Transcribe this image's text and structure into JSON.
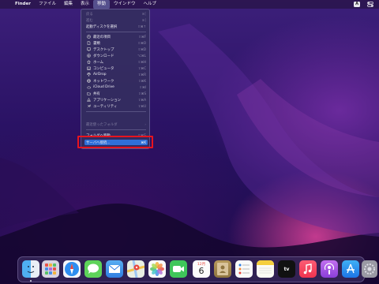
{
  "menubar": {
    "apple": "",
    "app_name": "Finder",
    "items": [
      "ファイル",
      "編集",
      "表示",
      "移動",
      "ウインドウ",
      "ヘルプ"
    ],
    "active_item": "移動",
    "input_source": "A"
  },
  "go_menu": {
    "items": [
      {
        "label": "戻る",
        "shortcut": "⌘[",
        "icon": "",
        "enabled": false
      },
      {
        "label": "進む",
        "shortcut": "⌘]",
        "icon": "",
        "enabled": false
      },
      {
        "label": "起動ディスクを選択",
        "shortcut": "⇧⌘↑",
        "icon": "",
        "enabled": true
      },
      {
        "label": "最近の項目",
        "shortcut": "⇧⌘F",
        "icon": "recents-icon",
        "enabled": true
      },
      {
        "label": "書類",
        "shortcut": "⇧⌘O",
        "icon": "document-icon",
        "enabled": true
      },
      {
        "label": "デスクトップ",
        "shortcut": "⇧⌘D",
        "icon": "desktop-icon",
        "enabled": true
      },
      {
        "label": "ダウンロード",
        "shortcut": "⌥⌘L",
        "icon": "download-icon",
        "enabled": true
      },
      {
        "label": "ホーム",
        "shortcut": "⇧⌘H",
        "icon": "home-icon",
        "enabled": true
      },
      {
        "label": "コンピュータ",
        "shortcut": "⇧⌘C",
        "icon": "computer-icon",
        "enabled": true
      },
      {
        "label": "AirDrop",
        "shortcut": "⇧⌘R",
        "icon": "airdrop-icon",
        "enabled": true
      },
      {
        "label": "ネットワーク",
        "shortcut": "⇧⌘K",
        "icon": "network-icon",
        "enabled": true
      },
      {
        "label": "iCloud Drive",
        "shortcut": "⇧⌘I",
        "icon": "icloud-icon",
        "enabled": true
      },
      {
        "label": "共有",
        "shortcut": "⇧⌘S",
        "icon": "shared-icon",
        "enabled": true
      },
      {
        "label": "アプリケーション",
        "shortcut": "⇧⌘A",
        "icon": "applications-icon",
        "enabled": true
      },
      {
        "label": "ユーティリティ",
        "shortcut": "⇧⌘U",
        "icon": "utilities-icon",
        "enabled": true
      },
      {
        "label": "最近使ったフォルダ",
        "shortcut": "›",
        "icon": "",
        "enabled": false
      },
      {
        "label": "フォルダへ移動...",
        "shortcut": "⇧⌘G",
        "icon": "",
        "enabled": true
      },
      {
        "label": "サーバへ接続...",
        "shortcut": "⌘K",
        "icon": "",
        "enabled": true,
        "highlighted": true
      }
    ]
  },
  "dock": {
    "calendar_month": "12月",
    "calendar_day": "6",
    "tv_label": "tv",
    "icons": [
      "finder-icon",
      "launchpad-icon",
      "safari-icon",
      "messages-icon",
      "mail-icon",
      "maps-icon",
      "photos-icon",
      "facetime-icon",
      "calendar-icon",
      "contacts-icon",
      "reminders-icon",
      "notes-icon",
      "appletv-icon",
      "music-icon",
      "podcasts-icon",
      "appstore-icon",
      "system-preferences-icon"
    ]
  },
  "colors": {
    "highlight": "#2f6fd8",
    "annotation_box": "#e8141e"
  }
}
